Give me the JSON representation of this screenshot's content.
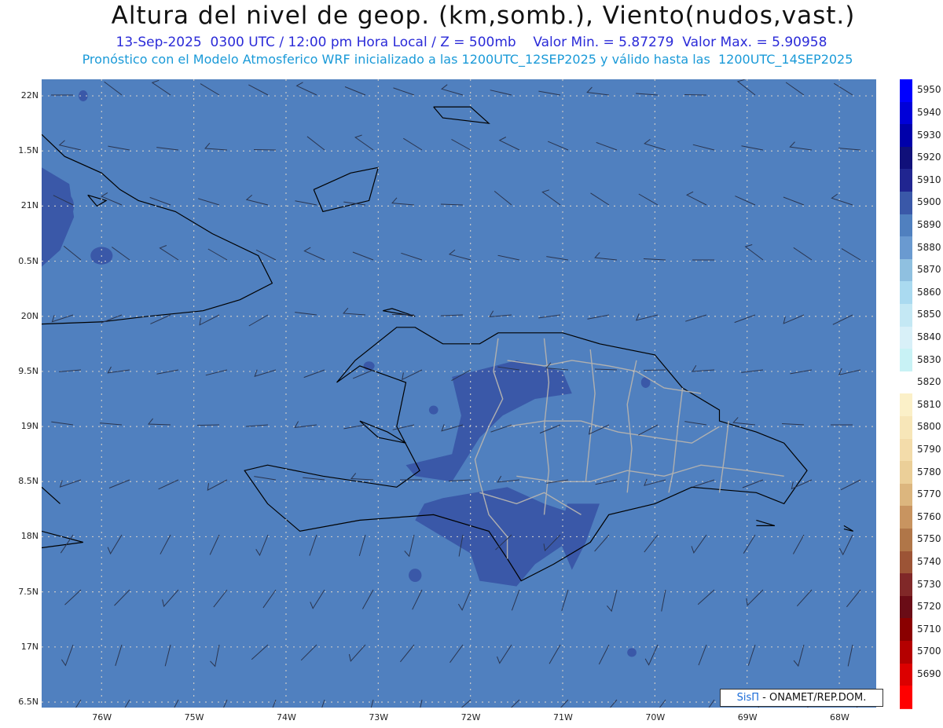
{
  "title": "Altura del nivel de geop. (km,somb.), Viento(nudos,vast.)",
  "subtitle": "13-Sep-2025  0300 UTC / 12:00 pm Hora Local / Z = 500mb    Valor Min. = 5.87279  Valor Max. = 5.90958",
  "subtitle2": "Pronóstico con el Modelo Atmosferico WRF inicializado a las 1200UTC_12SEP2025 y válido hasta las  1200UTC_14SEP2025",
  "map": {
    "lon_range": [
      -76.65,
      -67.6
    ],
    "lat_range": [
      16.45,
      22.15
    ],
    "lat_ticks": [
      {
        "value": 22.0,
        "label": "22N"
      },
      {
        "value": 21.5,
        "label": "1.5N"
      },
      {
        "value": 21.0,
        "label": "21N"
      },
      {
        "value": 20.5,
        "label": "0.5N"
      },
      {
        "value": 20.0,
        "label": "20N"
      },
      {
        "value": 19.5,
        "label": "9.5N"
      },
      {
        "value": 19.0,
        "label": "19N"
      },
      {
        "value": 18.5,
        "label": "8.5N"
      },
      {
        "value": 18.0,
        "label": "18N"
      },
      {
        "value": 17.5,
        "label": "7.5N"
      },
      {
        "value": 17.0,
        "label": "17N"
      },
      {
        "value": 16.5,
        "label": "6.5N"
      }
    ],
    "lon_ticks": [
      {
        "value": -76,
        "label": "76W"
      },
      {
        "value": -75,
        "label": "75W"
      },
      {
        "value": -74,
        "label": "74W"
      },
      {
        "value": -73,
        "label": "73W"
      },
      {
        "value": -72,
        "label": "72W"
      },
      {
        "value": -71,
        "label": "71W"
      },
      {
        "value": -70,
        "label": "70W"
      },
      {
        "value": -69,
        "label": "69W"
      },
      {
        "value": -68,
        "label": "68W"
      }
    ],
    "grid": true,
    "background_color": "#5080bf",
    "high_color": "#3a58a8",
    "coast_color": "#000000",
    "border_color": "#b0b0b0"
  },
  "colorbar": {
    "levels": [
      {
        "label": "5950",
        "color": "#0000ff"
      },
      {
        "label": "5940",
        "color": "#0000d8"
      },
      {
        "label": "5930",
        "color": "#0000aa"
      },
      {
        "label": "5920",
        "color": "#10107a"
      },
      {
        "label": "5910",
        "color": "#202590"
      },
      {
        "label": "5900",
        "color": "#3a58a8"
      },
      {
        "label": "5890",
        "color": "#5080bf"
      },
      {
        "label": "5880",
        "color": "#6a9ad0"
      },
      {
        "label": "5870",
        "color": "#8fc0e0"
      },
      {
        "label": "5860",
        "color": "#aadaf0"
      },
      {
        "label": "5850",
        "color": "#c4e8f4"
      },
      {
        "label": "5840",
        "color": "#d8f0f8"
      },
      {
        "label": "5830",
        "color": "#c8f2f5"
      },
      {
        "label": "5820",
        "color": "#ffffff"
      },
      {
        "label": "5810",
        "color": "#fbf0c8"
      },
      {
        "label": "5800",
        "color": "#f7e6b8"
      },
      {
        "label": "5790",
        "color": "#f3dcaa"
      },
      {
        "label": "5780",
        "color": "#ebcf98"
      },
      {
        "label": "5770",
        "color": "#dcb67e"
      },
      {
        "label": "5760",
        "color": "#c89460"
      },
      {
        "label": "5750",
        "color": "#b07648"
      },
      {
        "label": "5740",
        "color": "#9c5436"
      },
      {
        "label": "5730",
        "color": "#802828"
      },
      {
        "label": "5720",
        "color": "#6a0c16"
      },
      {
        "label": "5710",
        "color": "#8a0000"
      },
      {
        "label": "5700",
        "color": "#b40000"
      },
      {
        "label": "5690",
        "color": "#dc0000"
      },
      {
        "label": "",
        "color": "#ff0000"
      }
    ]
  },
  "credit": {
    "logo": "SisΠ",
    "org": "- ONAMET/REP.DOM."
  }
}
